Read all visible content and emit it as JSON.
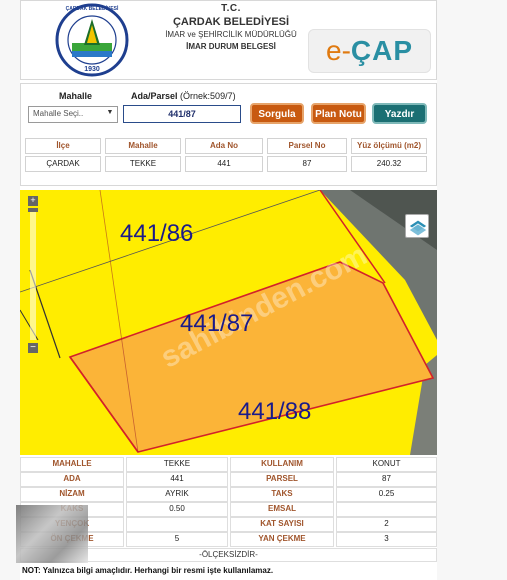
{
  "header": {
    "line1": "T.C.",
    "line2": "ÇARDAK BELEDİYESİ",
    "line3": "İMAR ve ŞEHİRCİLİK MÜDÜRLÜĞÜ",
    "line4": "İMAR DURUM BELGESİ",
    "logo_text": "ÇARDAK BELEDİYESİ",
    "logo_year": "1930",
    "brand_e": "e",
    "brand_dash": "-",
    "brand_cap": "ÇAP"
  },
  "query": {
    "mahalle_label": "Mahalle",
    "ada_parsel_label": "Ada/Parsel",
    "ada_parsel_hint": "(Örnek:509/7)",
    "mahalle_select": "Mahalle Seçi..",
    "ada_parsel_value": "441/87",
    "sorgula": "Sorgula",
    "plan_notu": "Plan Notu",
    "yazdir": "Yazdır",
    "headers": [
      "İlçe",
      "Mahalle",
      "Ada No",
      "Parsel No",
      "Yüz ölçümü (m2)"
    ],
    "values": [
      "ÇARDAK",
      "TEKKE",
      "441",
      "87",
      "240.32"
    ]
  },
  "map": {
    "parcel_top": "441/86",
    "parcel_main": "441/87",
    "parcel_bottom": "441/88",
    "zoom_in": "+",
    "zoom_out": "−",
    "colors": {
      "yellow": "#ffed00",
      "orange": "#fbb438",
      "red_border": "#d2222a",
      "imagery": "#6f7570"
    }
  },
  "info": {
    "rows": [
      [
        "MAHALLE",
        "TEKKE",
        "KULLANIM",
        "KONUT"
      ],
      [
        "ADA",
        "441",
        "PARSEL",
        "87"
      ],
      [
        "NİZAM",
        "AYRIK",
        "TAKS",
        "0.25"
      ],
      [
        "KAKS",
        "0.50",
        "EMSAL",
        ""
      ],
      [
        "YENÇOK",
        "",
        "KAT SAYISI",
        "2"
      ],
      [
        "ÖN ÇEKME",
        "5",
        "YAN ÇEKME",
        "3"
      ]
    ],
    "olcek": "-ÖLÇEKSİZDİR-",
    "note": "NOT: Yalnızca bilgi amaçlıdır. Herhangi bir resmi işte kullanılamaz."
  }
}
